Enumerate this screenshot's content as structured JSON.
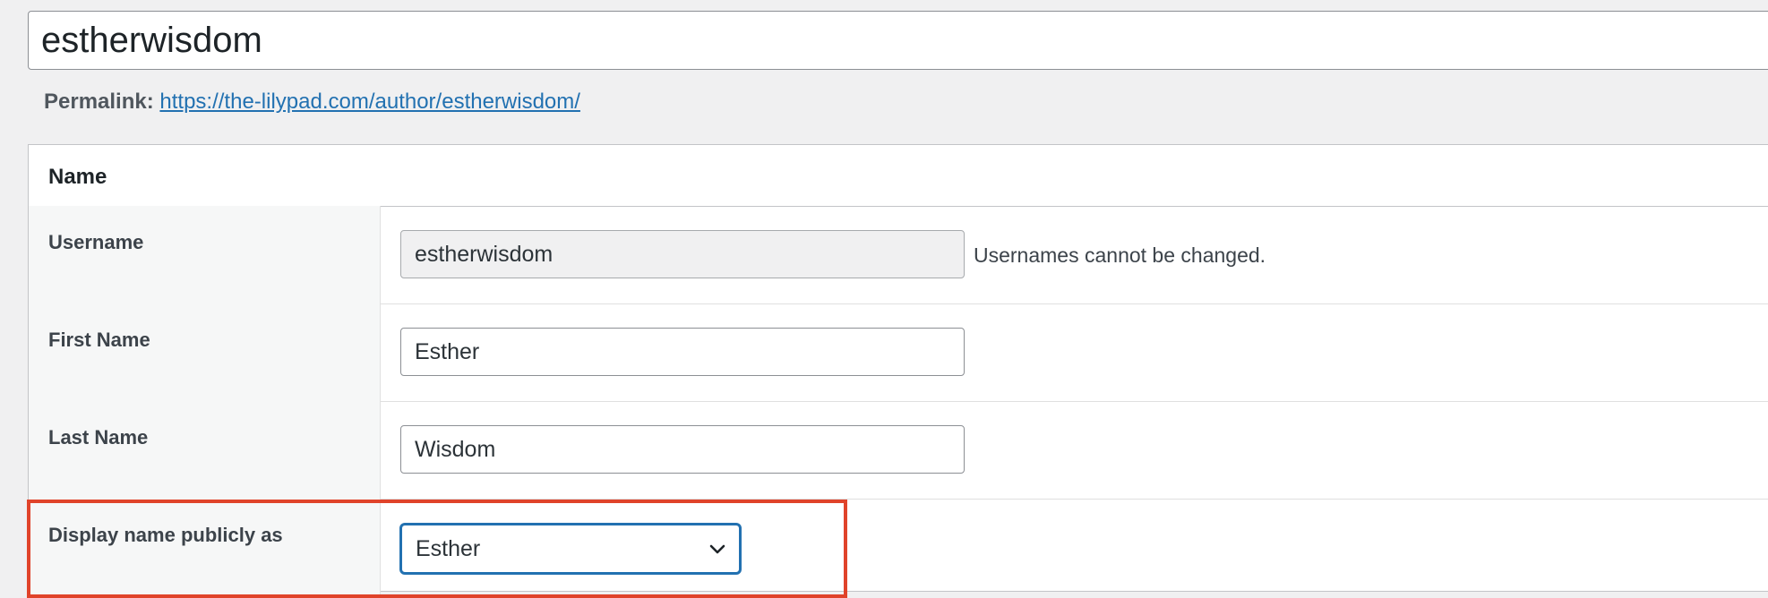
{
  "title": {
    "value": "estherwisdom"
  },
  "permalink": {
    "label": "Permalink:",
    "url": "https://the-lilypad.com/author/estherwisdom/"
  },
  "name_section": {
    "heading": "Name",
    "username": {
      "label": "Username",
      "value": "estherwisdom",
      "hint": "Usernames cannot be changed."
    },
    "first_name": {
      "label": "First Name",
      "value": "Esther"
    },
    "last_name": {
      "label": "Last Name",
      "value": "Wisdom"
    },
    "display_name": {
      "label": "Display name publicly as",
      "selected": "Esther"
    }
  },
  "icons": {
    "select_arrow": "chevron-down-icon"
  },
  "colors": {
    "link": "#2271b1",
    "focus": "#2271b1",
    "highlight": "#e0432a",
    "background": "#f0f0f1"
  }
}
